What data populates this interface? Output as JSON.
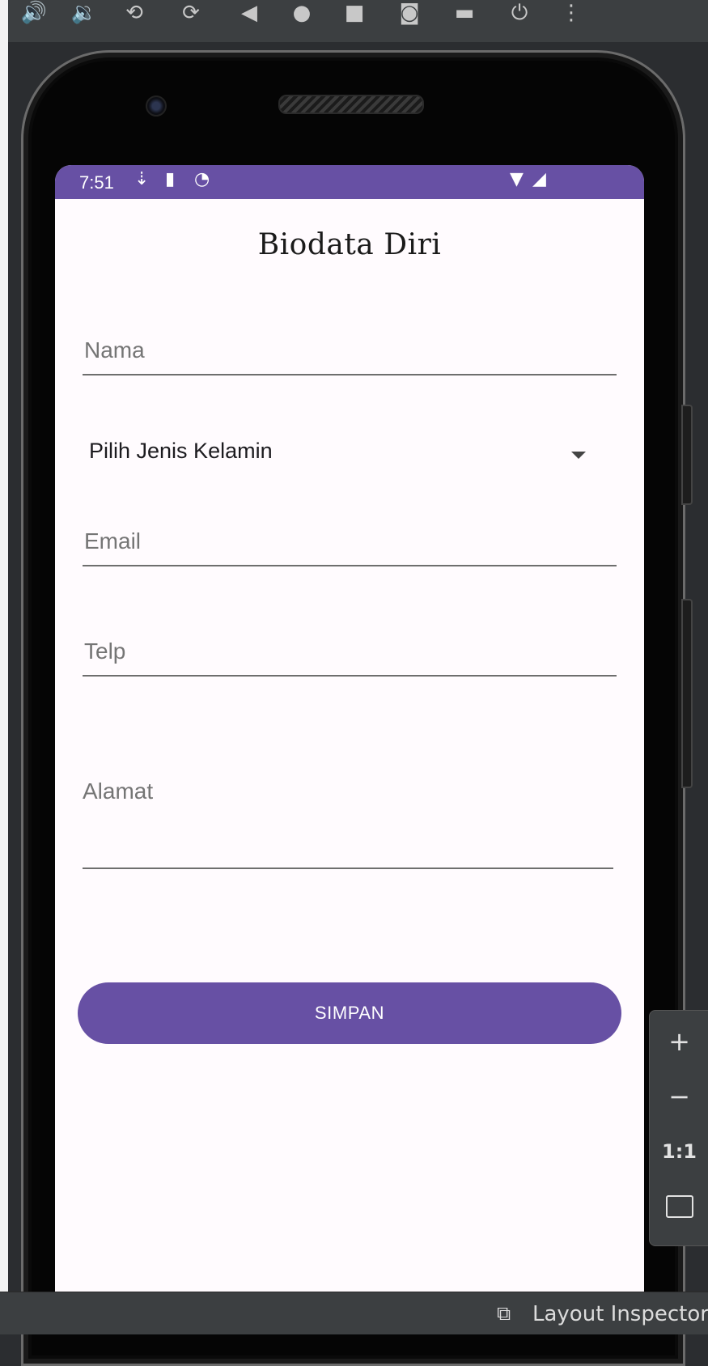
{
  "toolbar": {
    "icons": [
      "volume-up-icon",
      "volume-down-icon",
      "rotate-left-icon",
      "rotate-right-icon",
      "back-icon",
      "home-icon",
      "overview-icon",
      "screenshot-icon",
      "screenrecord-icon",
      "power-icon",
      "more-icon"
    ]
  },
  "device": {
    "status_bar": {
      "time": "7:51",
      "icons": [
        "download-icon",
        "sd-card-icon",
        "sync-icon",
        "wifi-icon",
        "signal-icon"
      ],
      "color": "#6750a4"
    },
    "app": {
      "title": "Biodata Diri",
      "fields": {
        "nama_placeholder": "Nama",
        "email_placeholder": "Email",
        "telp_placeholder": "Telp",
        "alamat_placeholder": "Alamat"
      },
      "gender_spinner": {
        "selected": "Pilih Jenis Kelamin"
      },
      "save_button": "SIMPAN",
      "accent_color": "#6750a4"
    }
  },
  "zoom_controls": {
    "zoom_in": "+",
    "zoom_out": "−",
    "actual_size": "1:1",
    "fit_screen_icon": "fit-screen-icon"
  },
  "bottom_bar": {
    "layout_inspector_label": "Layout Inspector"
  }
}
